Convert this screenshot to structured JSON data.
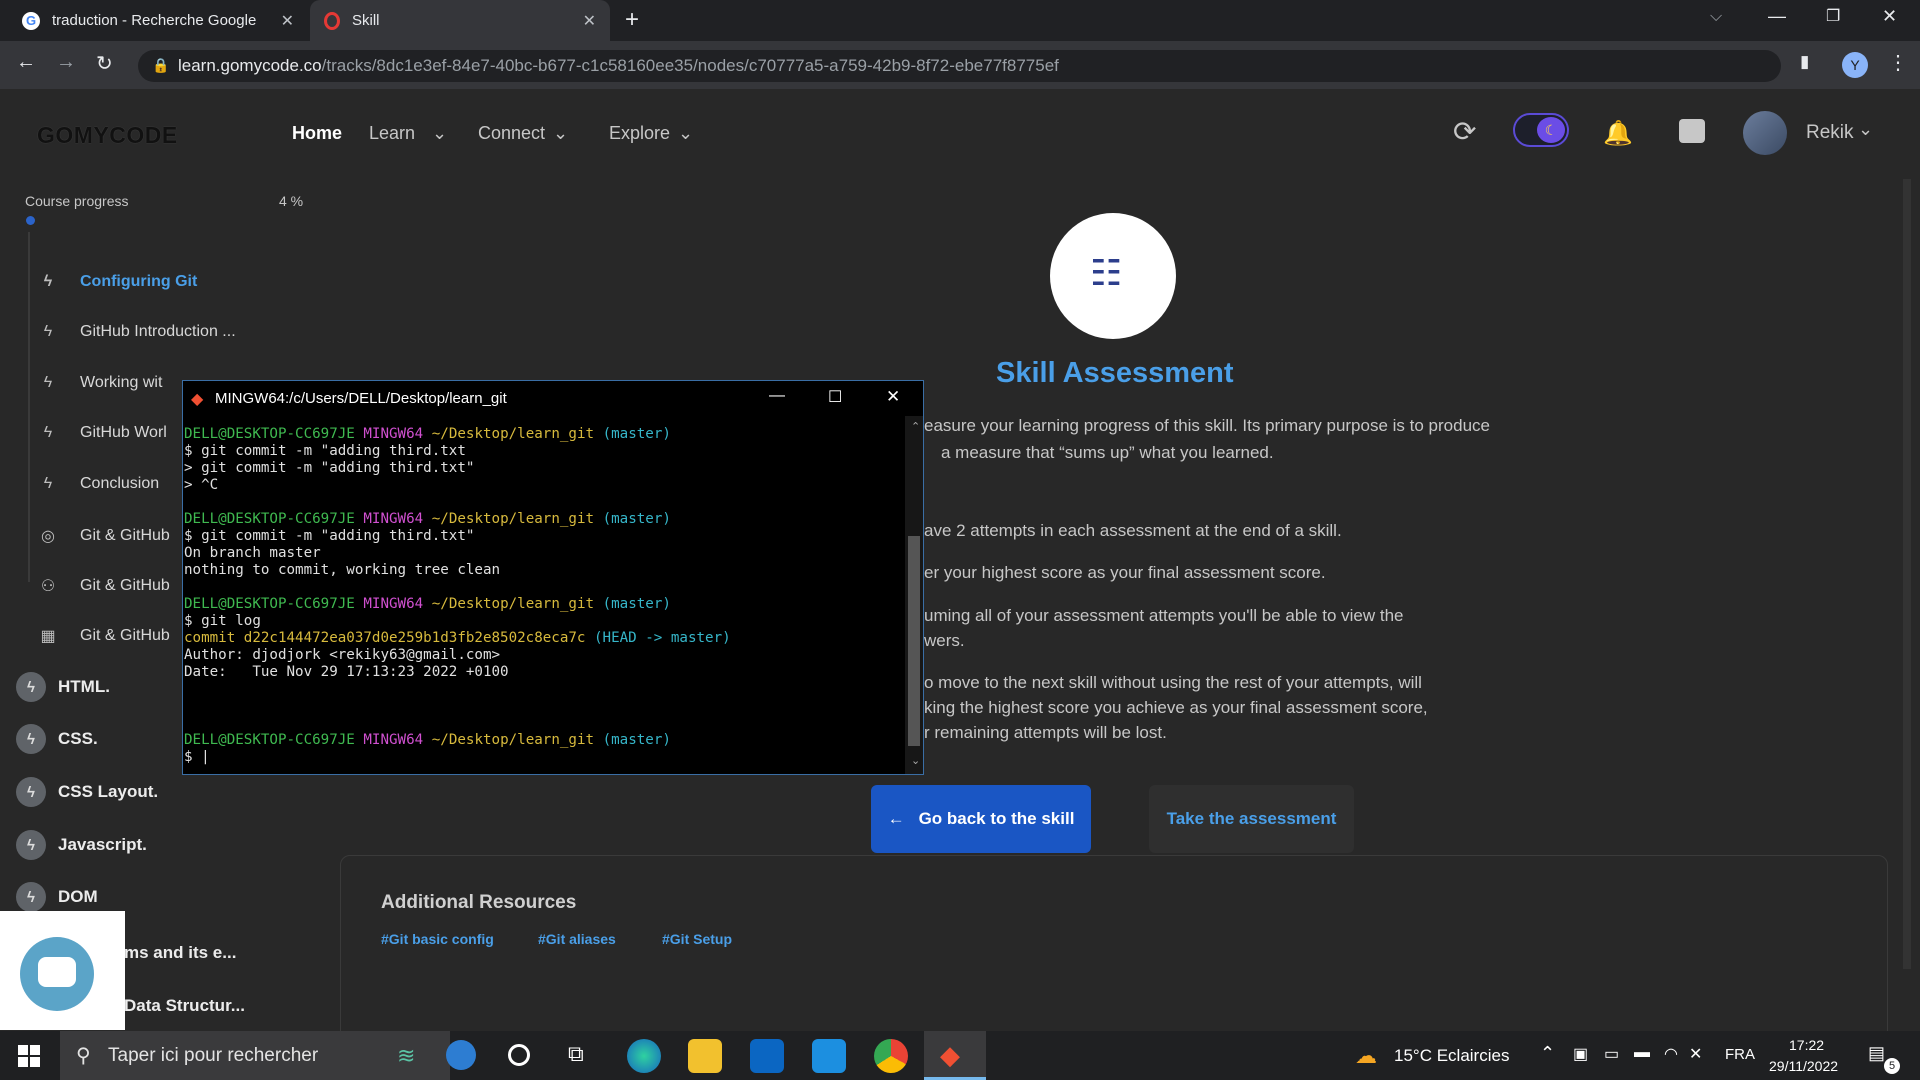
{
  "browser": {
    "tabs": [
      {
        "title": "traduction - Recherche Google",
        "icon": "google-icon"
      },
      {
        "title": "Skill",
        "icon": "gomycode-icon"
      }
    ],
    "url_host": "learn.gomycode.co",
    "url_path": "/tracks/8dc1e3ef-84e7-40bc-b677-c1c58160ee35/nodes/c70777a5-a759-42b9-8f72-ebe77f8775ef",
    "profile_initial": "Y"
  },
  "nav": {
    "logo": "GOMYCODE",
    "links": [
      "Home",
      "Learn",
      "Connect",
      "Explore"
    ],
    "user": "Rekik"
  },
  "sidebar": {
    "progress_label": "Course progress",
    "progress_value": "4 %",
    "items": [
      "Configuring Git",
      "GitHub Introduction ...",
      "Working wit",
      "GitHub Worl",
      "Conclusion",
      "Git & GitHub",
      "Git & GitHub",
      "Git & GitHub"
    ],
    "categories": [
      "HTML.",
      "CSS.",
      "CSS Layout.",
      "Javascript.",
      "DOM",
      "ms and its e...",
      "Data Structur..."
    ]
  },
  "main": {
    "title": "Skill Assessment",
    "intro_1": "easure your learning progress of this skill. Its primary purpose is to produce",
    "intro_2": "a measure that “sums up” what you learned.",
    "p1": "ave 2 attempts in each assessment at the end of a skill.",
    "p2": "er your highest score as your final assessment score.",
    "p3a": "uming all of your assessment attempts you'll be able to view the",
    "p3b": "wers.",
    "p4a": "o move to the next skill without using the rest of your attempts, will",
    "p4b": "king the highest score you achieve as your final assessment score,",
    "p4c": "r remaining attempts will be lost.",
    "back_button": "Go back to the skill",
    "take_button": "Take the assessment",
    "resources_title": "Additional Resources",
    "tags": [
      "#Git basic config",
      "#Git aliases",
      "#Git Setup"
    ]
  },
  "terminal": {
    "title": "MINGW64:/c/Users/DELL/Desktop/learn_git",
    "prompt_user": "DELL@DESKTOP-CC697JE",
    "prompt_sys": "MINGW64",
    "prompt_path": "~/Desktop/learn_git",
    "prompt_branch": "(master)",
    "block1": [
      "$ git commit -m \"adding third.txt",
      "> git commit -m \"adding third.txt\"",
      "> ^C"
    ],
    "block2": [
      "$ git commit -m \"adding third.txt\"",
      "On branch master",
      "nothing to commit, working tree clean"
    ],
    "block3_cmd": "$ git log",
    "commit_hash": "commit d22c144472ea037d0e259b1d3fb2e8502c8eca7c",
    "commit_ref": "(HEAD -> master)",
    "author": "Author: djodjork <rekiky63@gmail.com>",
    "date": "Date:   Tue Nov 29 17:13:23 2022 +0100",
    "final_prompt": "$ |"
  },
  "taskbar": {
    "search_placeholder": "Taper ici pour rechercher",
    "weather": "15°C  Eclaircies",
    "lang": "FRA",
    "time": "17:22",
    "date": "29/11/2022",
    "notifications": "5"
  },
  "colors": {
    "accent": "#4a9fe8",
    "primary_button": "#1a56c4",
    "terminal_green": "#3fb950",
    "terminal_magenta": "#d050d0",
    "terminal_yellow": "#d7ba3d",
    "terminal_cyan": "#36b6c9"
  }
}
